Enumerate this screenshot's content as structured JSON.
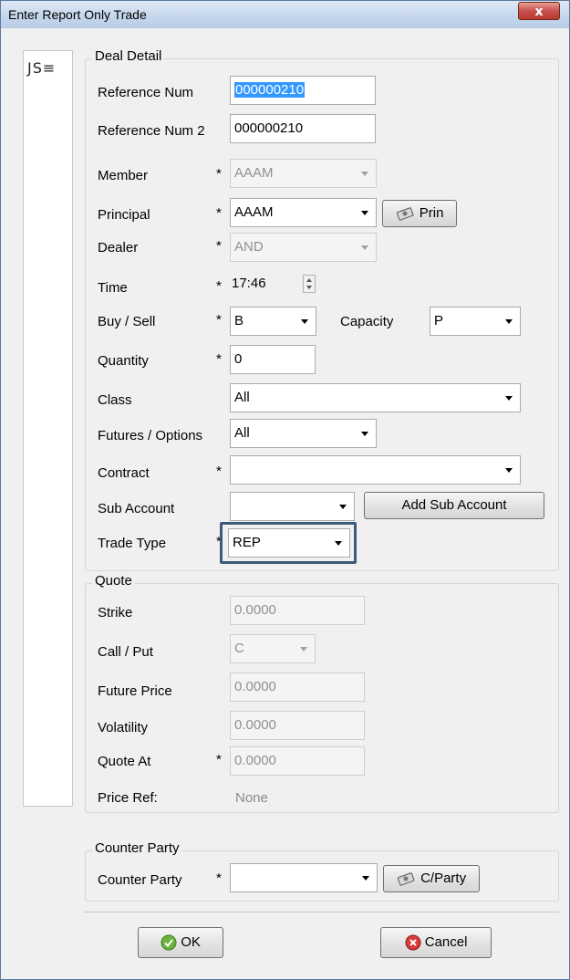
{
  "window": {
    "title": "Enter Report Only Trade",
    "close_glyph": "x"
  },
  "logo": {
    "text": "JS≡"
  },
  "deal": {
    "legend": "Deal Detail",
    "reference_num": {
      "label": "Reference Num",
      "value": "000000210"
    },
    "reference_num2": {
      "label": "Reference Num 2",
      "value": "000000210"
    },
    "member": {
      "label": "Member",
      "value": "AAAM",
      "required": "*"
    },
    "principal": {
      "label": "Principal",
      "value": "AAAM",
      "required": "*",
      "button": "Prin"
    },
    "dealer": {
      "label": "Dealer",
      "value": "AND",
      "required": "*"
    },
    "time": {
      "label": "Time",
      "value": "17:46",
      "required": "*"
    },
    "buy_sell": {
      "label": "Buy / Sell",
      "value": "B",
      "required": "*"
    },
    "capacity": {
      "label": "Capacity",
      "value": "P"
    },
    "quantity": {
      "label": "Quantity",
      "value": "0",
      "required": "*"
    },
    "class": {
      "label": "Class",
      "value": "All"
    },
    "futures_options": {
      "label": "Futures / Options",
      "value": "All"
    },
    "contract": {
      "label": "Contract",
      "value": "",
      "required": "*"
    },
    "sub_account": {
      "label": "Sub Account",
      "value": "",
      "button": "Add Sub Account"
    },
    "trade_type": {
      "label": "Trade Type",
      "value": "REP",
      "required": "*"
    }
  },
  "quote": {
    "legend": "Quote",
    "strike": {
      "label": "Strike",
      "value": "0.0000"
    },
    "call_put": {
      "label": "Call / Put",
      "value": "C"
    },
    "future_price": {
      "label": "Future Price",
      "value": "0.0000"
    },
    "volatility": {
      "label": "Volatility",
      "value": "0.0000"
    },
    "quote_at": {
      "label": "Quote At",
      "value": "0.0000",
      "required": "*"
    },
    "price_ref": {
      "label": "Price Ref:",
      "value": "None"
    }
  },
  "counter": {
    "legend": "Counter Party",
    "label": "Counter Party",
    "required": "*",
    "value": "",
    "button": "C/Party"
  },
  "buttons": {
    "ok": "OK",
    "cancel": "Cancel"
  },
  "colors": {
    "focus_border": "#3c5a7a",
    "highlight": "#3399ff",
    "close_red": "#c75050"
  },
  "icons": {
    "prin": "money-icon",
    "cparty": "money-icon",
    "ok": "check-circle-icon",
    "cancel": "cancel-circle-icon"
  }
}
